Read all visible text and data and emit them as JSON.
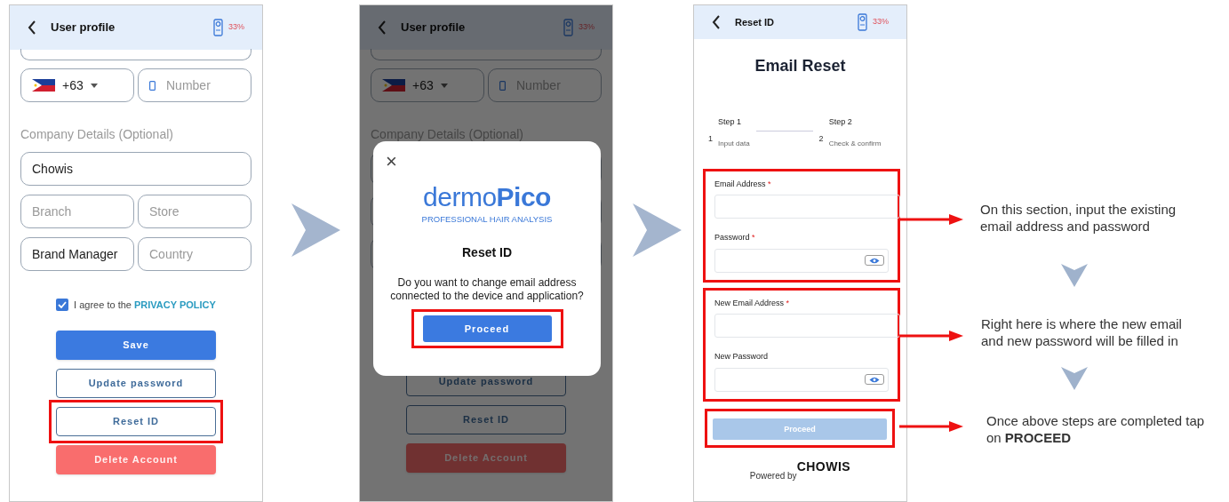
{
  "screens": [
    {
      "kind": "profile",
      "header": {
        "title": "User profile",
        "battery": "33%"
      },
      "country_code": "+63",
      "phone_placeholder": "Number",
      "section_label": "Company Details (Optional)",
      "company_rows": [
        [
          {
            "value": "Chowis"
          }
        ],
        [
          {
            "placeholder": "Branch"
          },
          {
            "placeholder": "Store"
          }
        ],
        [
          {
            "value": "Brand Manager"
          },
          {
            "placeholder": "Country"
          }
        ]
      ],
      "agree": {
        "checked": true,
        "text": "I agree to the",
        "link": "PRIVACY POLICY"
      },
      "buttons": [
        {
          "label": "Save",
          "kind": "primary",
          "highlighted": false
        },
        {
          "label": "Update password",
          "kind": "outline",
          "highlighted": false
        },
        {
          "label": "Reset ID",
          "kind": "outline",
          "highlighted": true
        },
        {
          "label": "Delete Account",
          "kind": "danger",
          "highlighted": false
        }
      ]
    },
    {
      "kind": "profile",
      "header": {
        "title": "User profile",
        "battery": "33%"
      },
      "country_code": "+63",
      "phone_placeholder": "Number",
      "section_label": "Company Details (Optional)",
      "buttons": [
        {
          "label": "Update password",
          "kind": "outline",
          "highlighted": false
        },
        {
          "label": "Reset ID",
          "kind": "outline",
          "highlighted": false
        },
        {
          "label": "Delete Account",
          "kind": "danger",
          "highlighted": false
        }
      ],
      "dialog": {
        "close": "×",
        "brand": "dermo",
        "brand_accent": "Pico",
        "tagline": "PROFESSIONAL HAIR ANALYSIS",
        "title": "Reset ID",
        "message": "Do you want to change email address connected to the device and application?",
        "button": {
          "label": "Proceed",
          "highlighted": true
        }
      }
    },
    {
      "kind": "reset",
      "header": {
        "title": "Reset ID",
        "battery": "33%"
      },
      "title": "Email Reset",
      "steps": [
        {
          "number": "1",
          "title": "Step 1",
          "caption": "Input data"
        },
        {
          "number": "2",
          "title": "Step 2",
          "caption": "Check & confirm"
        }
      ],
      "groups": [
        {
          "highlighted": true,
          "fields": [
            {
              "label": "Email Address",
              "required_mark": "*",
              "kind": "text"
            },
            {
              "label": "Password",
              "required_mark": "*",
              "kind": "password"
            }
          ]
        },
        {
          "highlighted": true,
          "fields": [
            {
              "label": "New Email Address",
              "required_mark": "*",
              "kind": "text"
            },
            {
              "label": "New Password",
              "kind": "password"
            }
          ]
        }
      ],
      "button": {
        "label": "Proceed",
        "disabled": true,
        "highlighted": true
      },
      "footer": {
        "text": "Powered by",
        "logo": "CHOWIS"
      }
    }
  ],
  "notes": [
    {
      "text": "On this section, input the existing email address and password"
    },
    {
      "text": "Right here is where the new email and new password will be filled in"
    },
    {
      "text": "Once above steps are completed tap on **PROCEED**"
    }
  ]
}
